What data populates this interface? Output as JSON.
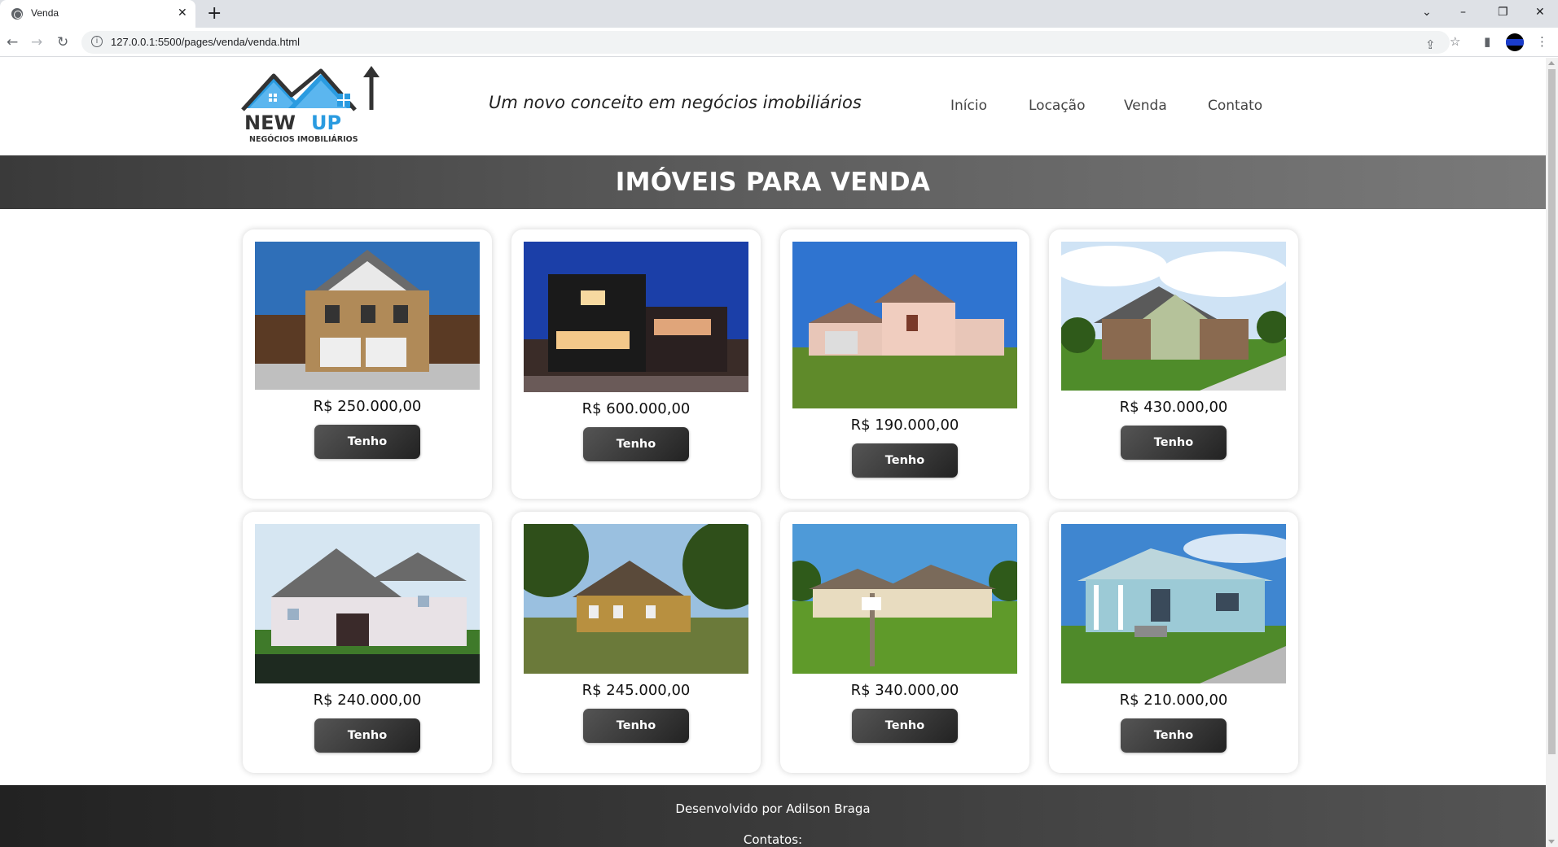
{
  "browser": {
    "tab_title": "Venda",
    "tab_close": "✕",
    "new_tab": "+",
    "url": "127.0.0.1:5500/pages/venda/venda.html",
    "controls": {
      "chevron": "⌄",
      "minimize": "–",
      "restore": "❐",
      "close": "✕"
    },
    "nav": {
      "back": "←",
      "forward": "→",
      "reload": "↻"
    },
    "omni_icons": {
      "share": "⇪",
      "star": "☆",
      "sidepanel": "▮",
      "menu": "⋮"
    }
  },
  "site": {
    "logo": {
      "line1": "NEW UP",
      "line2": "NEGÓCIOS IMOBILIÁRIOS"
    },
    "tagline": "Um novo conceito em negócios imobiliários",
    "nav": [
      "Início",
      "Locação",
      "Venda",
      "Contato"
    ],
    "banner_title": "IMÓVEIS PARA VENDA",
    "button_label": "Tenho Interesse",
    "listings": [
      {
        "price": "R$ 250.000,00",
        "scene": "two-story suburban house with double garage"
      },
      {
        "price": "R$ 600.000,00",
        "scene": "modern house at night"
      },
      {
        "price": "R$ 190.000,00",
        "scene": "stucco house with lawn"
      },
      {
        "price": "R$ 430.000,00",
        "scene": "brick house with driveway"
      },
      {
        "price": "R$ 240.000,00",
        "scene": "house under construction"
      },
      {
        "price": "R$ 245.000,00",
        "scene": "yellow house among trees"
      },
      {
        "price": "R$ 340.000,00",
        "scene": "beige house with large lawn"
      },
      {
        "price": "R$ 210.000,00",
        "scene": "blue cottage with porch"
      }
    ],
    "footer": {
      "developed_by": "Desenvolvido por Adilson Braga",
      "contacts": "Contatos:"
    }
  }
}
